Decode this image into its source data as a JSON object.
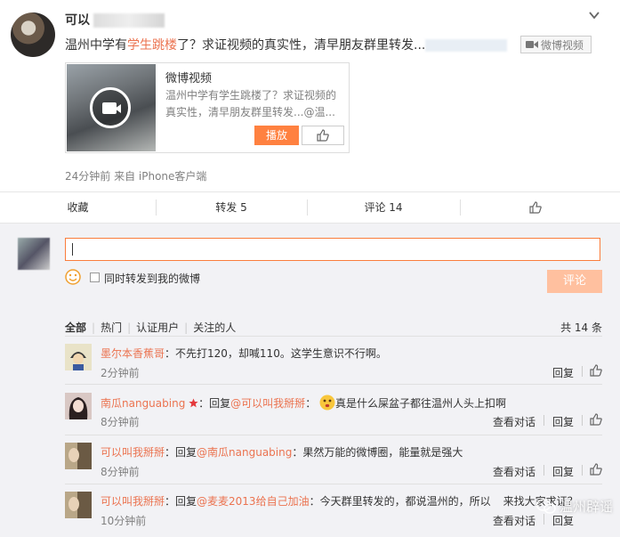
{
  "post": {
    "username": "可以",
    "content_prefix": "温州中学有",
    "content_highlight": "学生跳楼",
    "content_rest": "了？求证视频的真实性，清早朋友群里转发...",
    "video_link_label": "微博视频",
    "card": {
      "title": "微博视频",
      "desc": "温州中学有学生跳楼了？求证视频的真实性，清早朋友群里转发...@温...",
      "play_label": "播放"
    },
    "meta": "24分钟前 来自 iPhone客户端"
  },
  "actions": {
    "favorite": "收藏",
    "repost": "转发 5",
    "comment": "评论 14"
  },
  "composer": {
    "checkbox_label": "同时转发到我的微博",
    "submit_label": "评论"
  },
  "filters": {
    "all": "全部",
    "hot": "热门",
    "verified": "认证用户",
    "following": "关注的人",
    "total": "共 14 条"
  },
  "comments": [
    {
      "user": "墨尔本香蕉哥",
      "text": "：不先打120，却喊110。这学生意识不行啊。",
      "time": "2分钟前",
      "reply": "回复"
    },
    {
      "user": "南瓜nanguabing",
      "text_a": "：回复",
      "mention": "@可以叫我掰掰",
      "text_b": "：",
      "text_c": "真是什么屎盆子都往温州人头上扣啊",
      "time": "8分钟前",
      "view": "查看对话",
      "reply": "回复"
    },
    {
      "user": "可以叫我掰掰",
      "text_a": "：回复",
      "mention": "@南瓜nanguabing",
      "text_b": "：果然万能的微博圈，能量就是强大",
      "time": "8分钟前",
      "view": "查看对话",
      "reply": "回复"
    },
    {
      "user": "可以叫我掰掰",
      "text_a": "：回复",
      "mention": "@麦麦2013给自己加油",
      "text_b": "：今天群里转发的，都说温州的，所以",
      "text_c": "来找大家求证？",
      "time": "10分钟前",
      "view": "查看对话",
      "reply": "回复"
    }
  ],
  "watermark": "温州辟谣",
  "colors": {
    "accent": "#eb7350",
    "play_button": "#ff8140",
    "comment_button": "#ffc09f",
    "input_border": "#fa7d3c",
    "comment_area_bg": "#f2f2f5"
  }
}
